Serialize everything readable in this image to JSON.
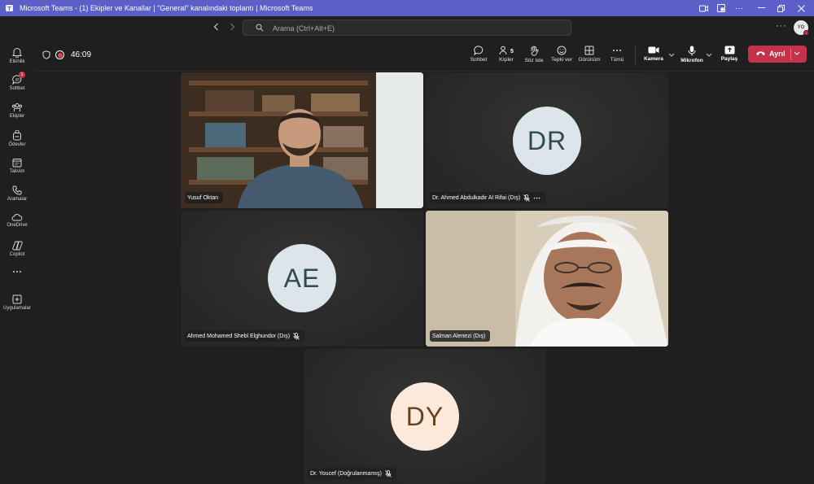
{
  "window": {
    "title": "Microsoft Teams - (1) Ekipler ve Kanallar | \"General\" kanalındaki toplantı | Microsoft Teams"
  },
  "search": {
    "placeholder": "Arama (Ctrl+Alt+E)"
  },
  "user": {
    "initials": "YO"
  },
  "rail": {
    "items": [
      {
        "label": "Etkinlik",
        "icon": "bell-icon"
      },
      {
        "label": "Sohbet",
        "icon": "chat-icon",
        "badge": "1"
      },
      {
        "label": "Ekipler",
        "icon": "teams-icon"
      },
      {
        "label": "Ödevler",
        "icon": "backpack-icon"
      },
      {
        "label": "Takvim",
        "icon": "calendar-icon"
      },
      {
        "label": "Aramalar",
        "icon": "phone-icon"
      },
      {
        "label": "OneDrive",
        "icon": "cloud-icon"
      },
      {
        "label": "Copilot",
        "icon": "copilot-icon"
      },
      {
        "label": "",
        "icon": "more-icon"
      },
      {
        "label": "Uygulamalar",
        "icon": "add-app-icon"
      }
    ]
  },
  "meeting": {
    "timer": "46:09",
    "toolbar": {
      "chat": "Sohbet",
      "people": "Kişiler",
      "people_count": "5",
      "raise_hand": "Söz iste",
      "react": "Tepki ver",
      "view": "Görünüm",
      "more": "Tümü",
      "camera": "Kamera",
      "mic": "Mikrofon",
      "share": "Paylaş",
      "leave": "Ayrıl"
    },
    "participants": [
      {
        "name": "Yusuf Oktan",
        "initials": "",
        "video": true,
        "muted": false
      },
      {
        "name": "Dr. Ahmed Abdulkadir Al Rifai (Dış)",
        "initials": "DR",
        "video": false,
        "muted": true,
        "avatar_color": "#dce6ea",
        "text_color": "#2f4a55"
      },
      {
        "name": "Ahmed Mohamed Shebl Elghundor (Dış)",
        "initials": "AE",
        "video": false,
        "muted": true,
        "avatar_color": "#dce6ea",
        "text_color": "#2f4a55"
      },
      {
        "name": "Salman Alenezi (Dış)",
        "initials": "",
        "video": true,
        "muted": false
      },
      {
        "name": "Dr. Youcef (Doğrulanmamış)",
        "initials": "DY",
        "video": false,
        "muted": true,
        "avatar_color": "#fbeadb",
        "text_color": "#6b3f1c"
      }
    ]
  }
}
